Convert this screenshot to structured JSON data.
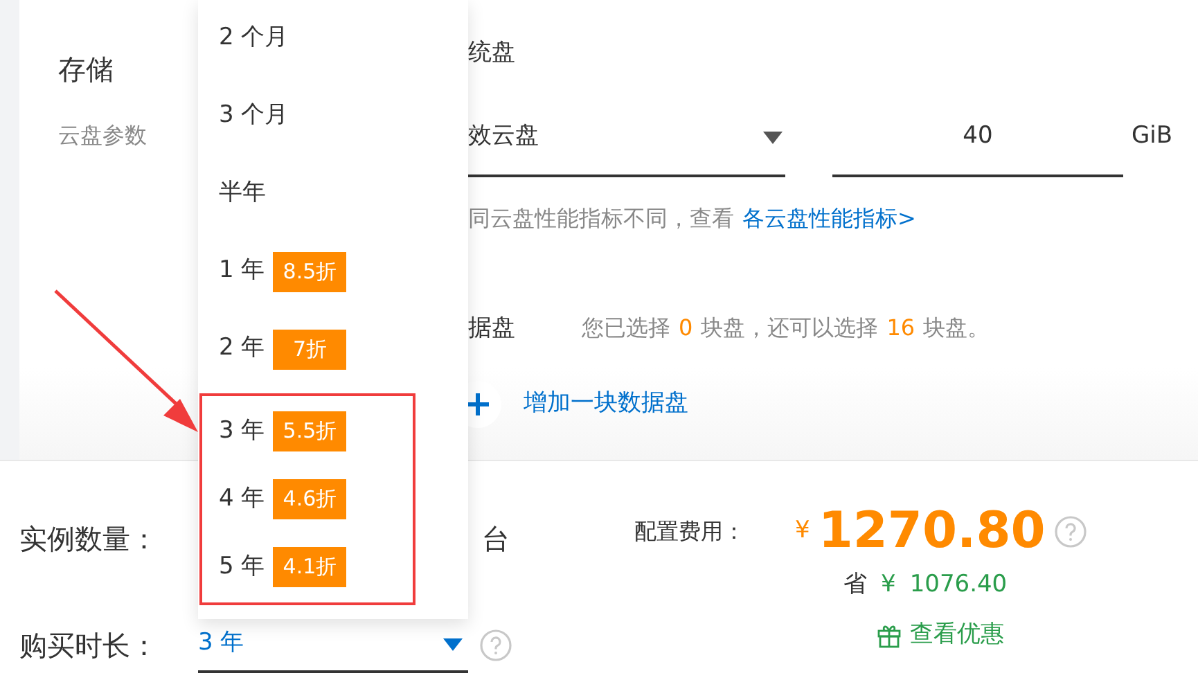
{
  "storage": {
    "title": "存储",
    "description": "云盘参数"
  },
  "system_disk": {
    "label": "统盘",
    "type": "效云盘",
    "size": "40",
    "unit": "GiB",
    "hint": "同云盘性能指标不同，查看",
    "hint_link": "各云盘性能指标>"
  },
  "data_disk": {
    "label": "据盘",
    "note": [
      {
        "kind": "text",
        "text": "您已选择"
      },
      {
        "kind": "count",
        "text": "0"
      },
      {
        "kind": "text",
        "text": "块盘，还可以选择"
      },
      {
        "kind": "count",
        "text": "16"
      },
      {
        "kind": "text",
        "text": "块盘。"
      }
    ],
    "add_link": "增加一块数据盘"
  },
  "instance_count": {
    "label": "实例数量：",
    "unit": "台"
  },
  "duration": {
    "label": "购买时长：",
    "value": "3 年"
  },
  "duration_options": [
    {
      "label": "2 个月"
    },
    {
      "label": "3 个月"
    },
    {
      "label": "半年"
    },
    {
      "label": "1 年",
      "discount": "8.5折"
    },
    {
      "label": "2 年",
      "discount": "7折"
    },
    {
      "label": "3 年",
      "discount": "5.5折",
      "highlighted": true
    },
    {
      "label": "4 年",
      "discount": "4.6折",
      "highlighted": true
    },
    {
      "label": "5 年",
      "discount": "4.1折",
      "highlighted": true
    }
  ],
  "price": {
    "label": "配置费用：",
    "currency": "¥",
    "amount": "1270.80",
    "saving_label": "省",
    "saving_currency": "¥",
    "saving_amount": "1076.40",
    "offers_link": "查看优惠"
  }
}
